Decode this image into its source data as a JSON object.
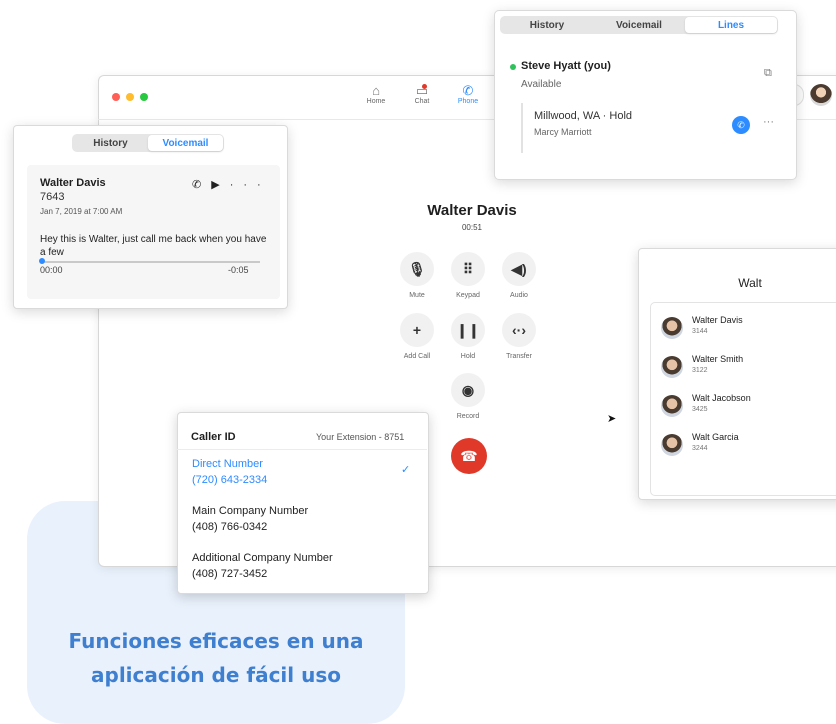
{
  "promo": {
    "line1": "Funciones eficaces en una",
    "line2": "aplicación de fácil uso"
  },
  "nav": [
    {
      "label": "Home",
      "icon": "home-icon"
    },
    {
      "label": "Chat",
      "icon": "chat-icon"
    },
    {
      "label": "Phone",
      "icon": "phone-icon"
    }
  ],
  "call": {
    "name": "Walter Davis",
    "duration": "00:51",
    "controls": [
      {
        "label": "Mute",
        "icon": "microphone-icon"
      },
      {
        "label": "Keypad",
        "icon": "keypad-icon"
      },
      {
        "label": "Audio",
        "icon": "speaker-icon"
      },
      {
        "label": "Add Call",
        "icon": "plus-icon"
      },
      {
        "label": "Hold",
        "icon": "pause-icon"
      },
      {
        "label": "Transfer",
        "icon": "transfer-icon"
      },
      {
        "label": "Record",
        "icon": "record-icon"
      }
    ]
  },
  "voicemail": {
    "tabs": [
      "History",
      "Voicemail"
    ],
    "active_tab": "Voicemail",
    "caller": "Walter Davis",
    "number": "7643",
    "date": "Jan 7, 2019 at 7:00 AM",
    "message": "Hey this is Walter, just call me back when you have a few",
    "time_start": "00:00",
    "time_remaining": "-0:05",
    "progress": 0.0
  },
  "lines": {
    "tabs": [
      "History",
      "Voicemail",
      "Lines"
    ],
    "active_tab": "Lines",
    "user": "Steve Hyatt (you)",
    "status": "Available",
    "line_location": "Millwood, WA · Hold",
    "line_contact": "Marcy Marriott",
    "more": "···",
    "status_color": "#2fc25b"
  },
  "search": {
    "query": "Walt",
    "results": [
      {
        "name": "Walter Davis",
        "ext": "3144"
      },
      {
        "name": "Walter Smith",
        "ext": "3122"
      },
      {
        "name": "Walt Jacobson",
        "ext": "3425"
      },
      {
        "name": "Walt Garcia",
        "ext": "3244"
      }
    ]
  },
  "caller_id": {
    "title": "Caller ID",
    "your_extension": "Your Extension - 8751",
    "options": [
      {
        "label": "Direct Number",
        "number": "(720) 643-2334",
        "selected": true
      },
      {
        "label": "Main Company Number",
        "number": "(408) 766-0342",
        "selected": false
      },
      {
        "label": "Additional Company Number",
        "number": "(408) 727-3452",
        "selected": false
      }
    ]
  },
  "colors": {
    "accent": "#2d8cff",
    "hangup": "#e0392a",
    "promo_text": "#3f7fd0",
    "promo_bg": "#e9f1fc"
  }
}
